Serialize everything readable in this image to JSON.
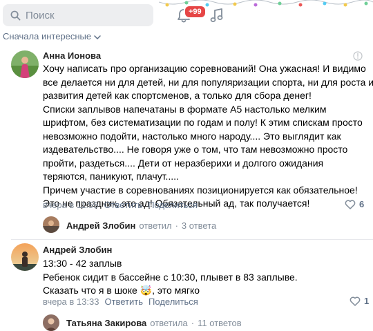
{
  "header": {
    "search_placeholder": "Поиск",
    "notifications_badge": "+99",
    "bell_icon": "bell-icon",
    "music_icon": "music-icon"
  },
  "sort_label": "Сначала интересные",
  "comments": [
    {
      "author": "Анна Ионова",
      "lines": [
        "Хочу написать про организацию соревнований! Она ужасная! И видимо",
        "все делается ни для детей, ни для популяризации спорта, ни для роста и",
        "развития детей как спортсменов, а только для сбора денег!",
        "Списки заплывов напечатаны в формате А5 настолько мелким",
        "шрифтом, без систематизации по годам и полу! К этим спискам просто",
        "невозможно подойти, настолько много народу.... Это выглядит как",
        "издевательство.... Не говоря уже о том, что там невозможно просто",
        "пройти, раздеться.... Дети от неразберихи и долгого ожидания",
        "теряются, паникуют, плачут.....",
        "Причем участие в соревнованиях позиционируется как обязательное!",
        "Это не праздник, это ад! Обязательный ад, так получается!"
      ],
      "time": "вчера в 11:55",
      "reply_label": "Ответить",
      "share_label": "Поделиться",
      "likes": "6",
      "thread": {
        "name": "Андрей Злобин",
        "verb": "ответил",
        "count": "3 ответа"
      }
    },
    {
      "author": "Андрей Злобин",
      "lines": [
        "13:30 - 42 заплыв",
        "Ребенок сидит в бассейне с 10:30, плывет в 83 заплыве.",
        "Сказать что я в шоке 🤯, это мягко"
      ],
      "time": "вчера в 13:33",
      "reply_label": "Ответить",
      "share_label": "Поделиться",
      "likes": "1",
      "thread": {
        "name": "Татьяна Закирова",
        "verb": "ответила",
        "count": "11 ответов"
      }
    }
  ],
  "colors": {
    "link": "#5f7087",
    "secondary": "#818c99",
    "badge": "#e64646",
    "search_bg": "#edeef0"
  }
}
